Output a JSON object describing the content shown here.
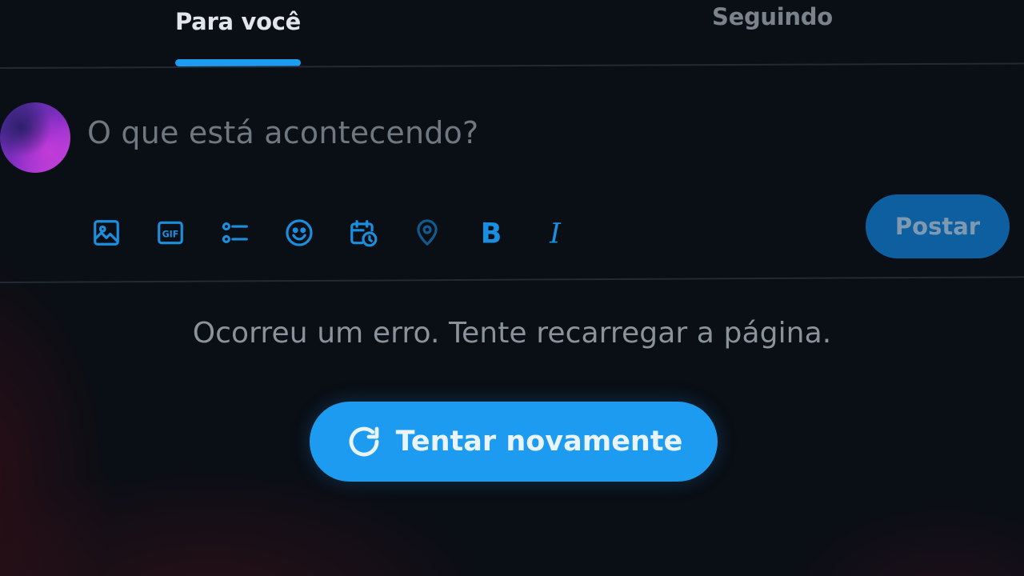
{
  "tabs": {
    "active_label": "Para você",
    "inactive_label": "Seguindo"
  },
  "composer": {
    "placeholder": "O que está acontecendo?",
    "post_label": "Postar",
    "toolbar_icons": [
      "image-icon",
      "gif-icon",
      "poll-icon",
      "emoji-icon",
      "schedule-icon",
      "location-icon",
      "bold-icon",
      "italic-icon"
    ],
    "gif_text": "GIF",
    "bold_text": "B",
    "italic_text": "I"
  },
  "error": {
    "message": "Ocorreu um erro. Tente recarregar a página.",
    "retry_label": "Tentar novamente"
  },
  "colors": {
    "accent": "#1d9bf0",
    "background": "#0a0e15",
    "muted_text": "#8a929c",
    "post_button_disabled": "#0e5fa0"
  }
}
